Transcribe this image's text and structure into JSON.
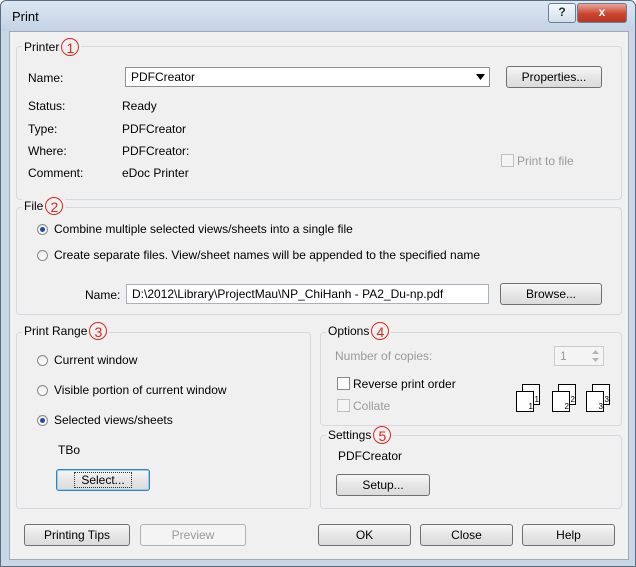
{
  "window": {
    "title": "Print",
    "help_label": "?",
    "close_label": "x"
  },
  "printer": {
    "legend": "Printer",
    "marker": "1",
    "name_label": "Name:",
    "name_value": "PDFCreator",
    "properties_label": "Properties...",
    "status_label": "Status:",
    "status_value": "Ready",
    "type_label": "Type:",
    "type_value": "PDFCreator",
    "where_label": "Where:",
    "where_value": "PDFCreator:",
    "comment_label": "Comment:",
    "comment_value": "eDoc Printer",
    "print_to_file_label": "Print to file"
  },
  "file": {
    "legend": "File",
    "marker": "2",
    "combine_label": "Combine multiple selected views/sheets into a single file",
    "separate_label": "Create separate files. View/sheet names will be appended to the specified name",
    "name_label": "Name:",
    "name_value": "D:\\2012\\Library\\ProjectMau\\NP_ChiHanh - PA2_Du-np.pdf",
    "browse_label": "Browse..."
  },
  "print_range": {
    "legend": "Print Range",
    "marker": "3",
    "current_window_label": "Current window",
    "visible_portion_label": "Visible portion of current window",
    "selected_views_label": "Selected views/sheets",
    "selection_name": "TBo",
    "select_label": "Select..."
  },
  "options": {
    "legend": "Options",
    "marker": "4",
    "copies_label": "Number of copies:",
    "copies_value": "1",
    "reverse_label": "Reverse print order",
    "collate_label": "Collate",
    "collate_icon_numbers": [
      "1",
      "1",
      "2",
      "2",
      "3",
      "3"
    ]
  },
  "settings": {
    "legend": "Settings",
    "marker": "5",
    "value": "PDFCreator",
    "setup_label": "Setup..."
  },
  "footer": {
    "printing_tips_label": "Printing Tips",
    "preview_label": "Preview",
    "ok_label": "OK",
    "close_label": "Close",
    "help_label": "Help"
  }
}
